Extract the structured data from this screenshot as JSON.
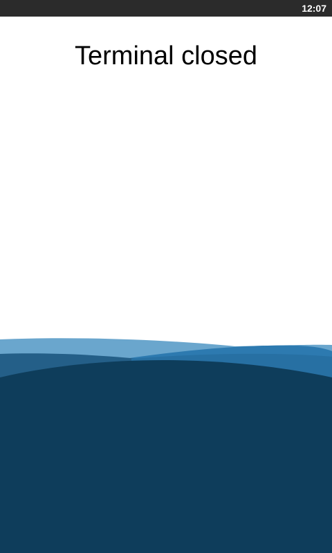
{
  "status_bar": {
    "time": "12:07"
  },
  "main": {
    "title": "Terminal closed"
  },
  "colors": {
    "status_bar_bg": "#2b2b2b",
    "wave_light": "#6aa6cd",
    "wave_mid": "#2770a3",
    "wave_dark_left": "#245f88",
    "wave_deep": "#0e3d5b"
  }
}
